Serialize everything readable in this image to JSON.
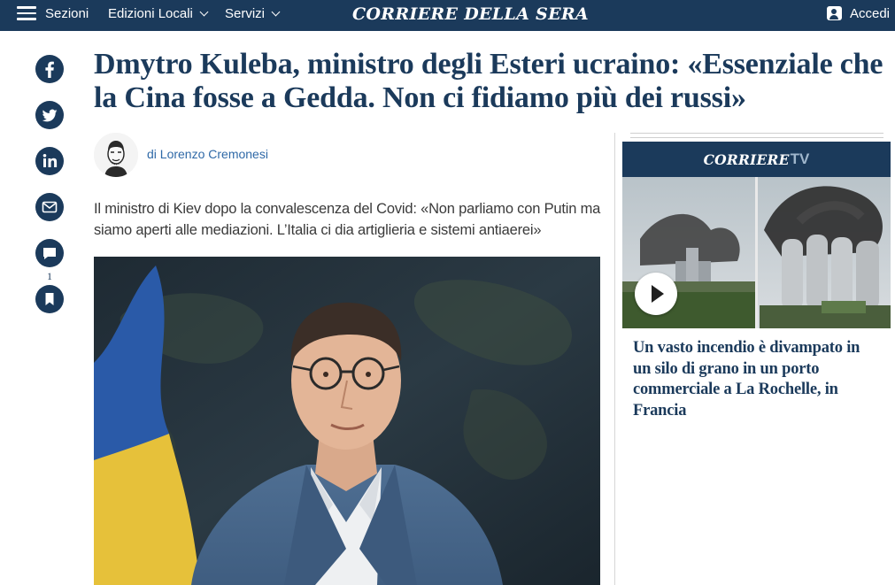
{
  "topbar": {
    "sections_label": "Sezioni",
    "editions_label": "Edizioni Locali",
    "services_label": "Servizi",
    "logo_text": "CORRIERE DELLA SERA",
    "login_label": "Accedi",
    "background_color": "#1b3a5b"
  },
  "share": {
    "icons": [
      "facebook-icon",
      "twitter-icon",
      "linkedin-icon",
      "mail-icon",
      "comment-icon",
      "bookmark-icon"
    ],
    "comment_count": "1"
  },
  "article": {
    "headline": "Dmytro Kuleba, ministro degli Esteri ucraino: «Essenziale che la Cina fosse a Gedda. Non ci fidiamo più dei russi»",
    "author": "di Lorenzo Cremonesi",
    "summary": "Il ministro di Kiev dopo la convalescenza del Covid: «Non parliamo con Putin ma siamo aperti alle mediazioni. L’Italia ci dia artiglieria e sistemi antiaerei»"
  },
  "sidebar": {
    "tv_brand": "CORRIERE",
    "tv_tag": "TV",
    "video_title": "Un vasto incendio è divampato in un silo di grano in un porto commerciale a La Rochelle, in Francia"
  },
  "colors": {
    "brand_navy": "#1b3a5b",
    "author_link": "#2f69a7"
  }
}
